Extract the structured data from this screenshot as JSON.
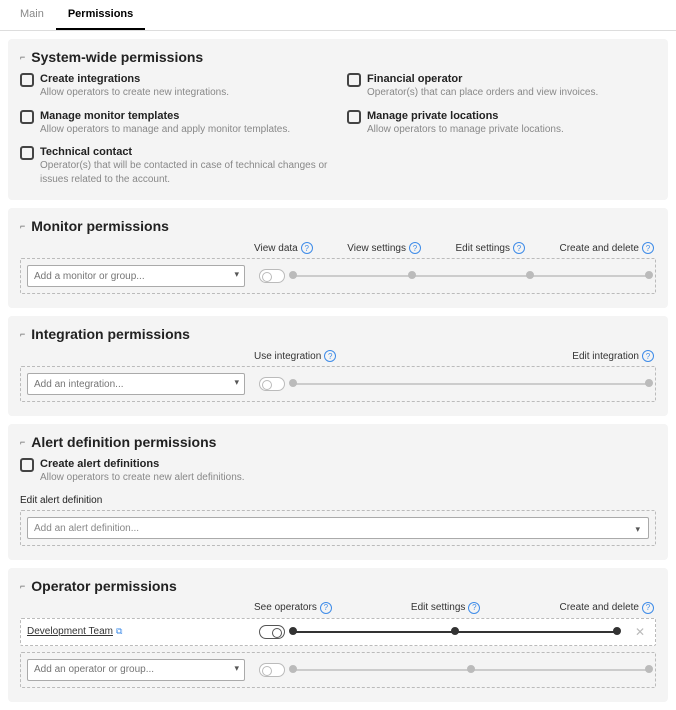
{
  "tabs": {
    "main": "Main",
    "permissions": "Permissions"
  },
  "system": {
    "title": "System-wide permissions",
    "items": [
      {
        "label": "Create integrations",
        "desc": "Allow operators to create new integrations."
      },
      {
        "label": "Financial operator",
        "desc": "Operator(s) that can place orders and view invoices."
      },
      {
        "label": "Manage monitor templates",
        "desc": "Allow operators to manage and apply monitor templates."
      },
      {
        "label": "Manage private locations",
        "desc": "Allow operators to manage private locations."
      },
      {
        "label": "Technical contact",
        "desc": "Operator(s) that will be contacted in case of technical changes or issues related to the account."
      }
    ]
  },
  "monitor": {
    "title": "Monitor permissions",
    "cols": [
      "View data",
      "View settings",
      "Edit settings",
      "Create and delete"
    ],
    "placeholder": "Add a monitor or group..."
  },
  "integration": {
    "title": "Integration permissions",
    "cols": [
      "Use integration",
      "Edit integration"
    ],
    "placeholder": "Add an integration..."
  },
  "alert": {
    "title": "Alert definition permissions",
    "create_label": "Create alert definitions",
    "create_desc": "Allow operators to create new alert definitions.",
    "sub": "Edit alert definition",
    "placeholder": "Add an alert definition..."
  },
  "operator": {
    "title": "Operator permissions",
    "cols": [
      "See operators",
      "Edit settings",
      "Create and delete"
    ],
    "team": "Development Team",
    "placeholder": "Add an operator or group..."
  }
}
